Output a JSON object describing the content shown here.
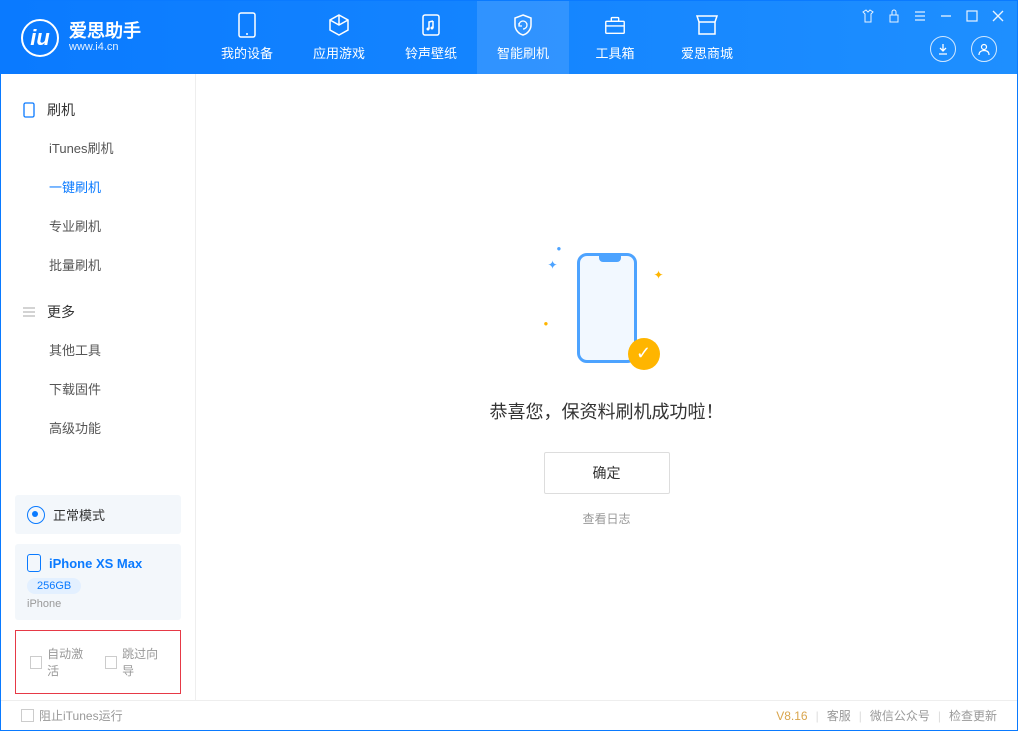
{
  "app": {
    "title": "爱思助手",
    "subtitle": "www.i4.cn"
  },
  "nav": {
    "tabs": [
      {
        "label": "我的设备"
      },
      {
        "label": "应用游戏"
      },
      {
        "label": "铃声壁纸"
      },
      {
        "label": "智能刷机"
      },
      {
        "label": "工具箱"
      },
      {
        "label": "爱思商城"
      }
    ],
    "active_index": 3
  },
  "sidebar": {
    "sections": [
      {
        "title": "刷机",
        "items": [
          "iTunes刷机",
          "一键刷机",
          "专业刷机",
          "批量刷机"
        ],
        "active_index": 1
      },
      {
        "title": "更多",
        "items": [
          "其他工具",
          "下载固件",
          "高级功能"
        ],
        "active_index": -1
      }
    ]
  },
  "mode": {
    "label": "正常模式"
  },
  "device": {
    "name": "iPhone XS Max",
    "storage": "256GB",
    "type": "iPhone"
  },
  "checks": {
    "auto_activate": "自动激活",
    "skip_guide": "跳过向导"
  },
  "main": {
    "success_text": "恭喜您，保资料刷机成功啦！",
    "ok_button": "确定",
    "view_log": "查看日志"
  },
  "footer": {
    "block_itunes": "阻止iTunes运行",
    "version": "V8.16",
    "links": [
      "客服",
      "微信公众号",
      "检查更新"
    ]
  }
}
